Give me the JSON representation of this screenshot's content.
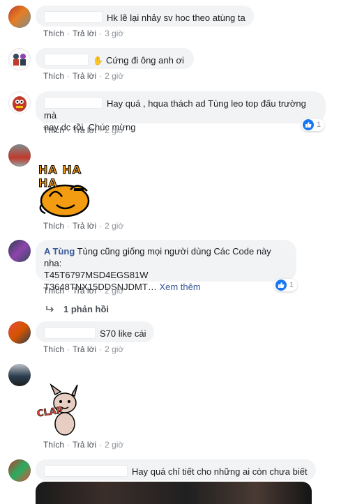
{
  "actions": {
    "like": "Thích",
    "reply": "Trả lời"
  },
  "comments": [
    {
      "text": "Hk lẽ lại nhảy sv hoc theo atùng ta",
      "time": "3 giờ"
    },
    {
      "text": "Cứng đi ông anh ơi",
      "time": "2 giờ"
    },
    {
      "text_line1": "Hay quá , hqua thách ad Tùng leo top đấu trường mà",
      "text_line2": "nay dc rồi. Chúc mừng",
      "time": "2 giờ",
      "reaction_count": "1"
    },
    {
      "sticker_text": "HA HA HA",
      "time": "2 giờ"
    },
    {
      "author": "A Tùng",
      "text_line1": "Tùng cũng giống mọi người dùng Các Code này nha:",
      "text_line2": "T45T6797MSD4EGS81W",
      "text_line3": "T3648TNX15DDSNJDMT…",
      "see_more": "Xem thêm",
      "time": "2 giờ",
      "reaction_count": "1",
      "replies": "1 phản hồi"
    },
    {
      "text": "S70 like cái",
      "time": "2 giờ"
    },
    {
      "sticker_text": "CLAP",
      "time": "2 giờ"
    },
    {
      "text": "Hay quá chỉ tiết cho những ai còn chưa biết"
    }
  ]
}
